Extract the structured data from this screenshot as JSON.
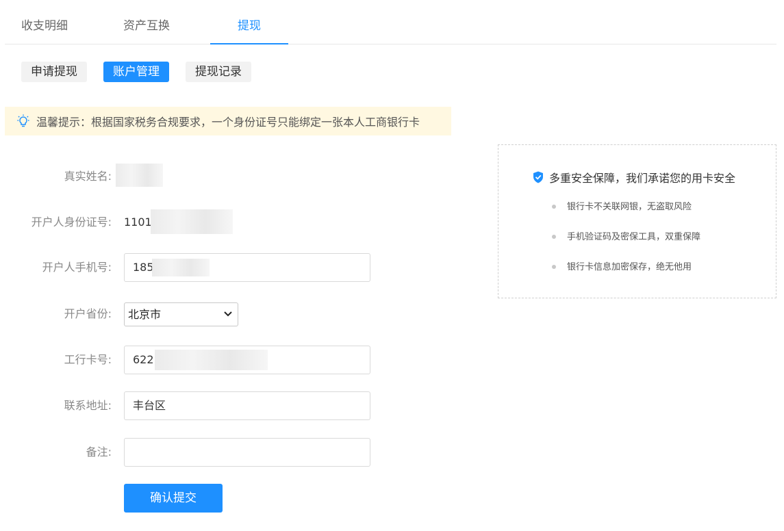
{
  "tabs": [
    {
      "label": "收支明细",
      "active": false
    },
    {
      "label": "资产互换",
      "active": false
    },
    {
      "label": "提现",
      "active": true
    }
  ],
  "subtabs": [
    {
      "label": "申请提现",
      "active": false
    },
    {
      "label": "账户管理",
      "active": true
    },
    {
      "label": "提现记录",
      "active": false
    }
  ],
  "notice": {
    "text": "温馨提示：根据国家税务合规要求，一个身份证号只能绑定一张本人工商银行卡",
    "icon": "lightbulb-icon"
  },
  "form": {
    "name_label": "真实姓名:",
    "id_label": "开户人身份证号:",
    "id_value": "1101",
    "phone_label": "开户人手机号:",
    "phone_value": "185",
    "province_label": "开户省份:",
    "province_value": "北京市",
    "card_label": "工行卡号:",
    "card_value": "622",
    "address_label": "联系地址:",
    "address_value": "丰台区",
    "remark_label": "备注:",
    "remark_value": "",
    "submit_label": "确认提交"
  },
  "security": {
    "title": "多重安全保障，我们承诺您的用卡安全",
    "icon": "shield-check-icon",
    "items": [
      "银行卡不关联网银，无盗取风险",
      "手机验证码及密保工具，双重保障",
      "银行卡信息加密保存，绝无他用"
    ]
  },
  "colors": {
    "accent": "#1e90ff",
    "notice_bg": "#fff8e1"
  }
}
